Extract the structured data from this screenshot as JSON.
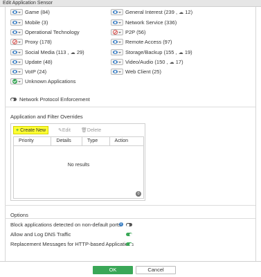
{
  "window": {
    "title": "Edit Application Sensor"
  },
  "categories_left": [
    {
      "icon": "eye-icon",
      "label": "Game (84)"
    },
    {
      "icon": "eye-icon",
      "label": "Mobile (3)"
    },
    {
      "icon": "eye-icon",
      "label": "Operational Technology"
    },
    {
      "icon": "block-icon",
      "label": "Proxy (178)"
    },
    {
      "icon": "eye-icon",
      "label": "Social Media (113 ,",
      "cloud": "29)"
    },
    {
      "icon": "eye-icon",
      "label": "Update (48)"
    },
    {
      "icon": "eye-icon",
      "label": "VoIP (24)"
    },
    {
      "icon": "check-icon",
      "label": "Unknown Applications"
    }
  ],
  "categories_right": [
    {
      "icon": "eye-icon",
      "label": "General Interest (239 ,",
      "cloud": "12)"
    },
    {
      "icon": "eye-icon",
      "label": "Network Service (336)"
    },
    {
      "icon": "block-icon",
      "label": "P2P (56)"
    },
    {
      "icon": "eye-icon",
      "label": "Remote Access (97)"
    },
    {
      "icon": "eye-icon",
      "label": "Storage/Backup (155 ,",
      "cloud": "19)"
    },
    {
      "icon": "eye-icon",
      "label": "Video/Audio (150 ,",
      "cloud": "17)"
    },
    {
      "icon": "eye-icon",
      "label": "Web Client (25)"
    }
  ],
  "network_protocol": {
    "label": "Network Protocol Enforcement",
    "enabled": false
  },
  "overrides": {
    "heading": "Application and Filter Overrides",
    "toolbar": {
      "create": "Create New",
      "edit": "Edit",
      "delete": "Delete"
    },
    "columns": [
      "Priority",
      "Details",
      "Type",
      "Action"
    ],
    "empty_text": "No results",
    "count": "0"
  },
  "options": {
    "heading": "Options",
    "items": [
      {
        "label": "Block applications detected on non-default ports",
        "enabled": false,
        "info": true
      },
      {
        "label": "Allow and Log DNS Traffic",
        "enabled": true
      },
      {
        "label": "Replacement Messages for HTTP-based Applications",
        "enabled": true
      }
    ]
  },
  "footer": {
    "ok": "OK",
    "cancel": "Cancel"
  },
  "colors": {
    "accent_green": "#3aa757",
    "highlight": "#ffff33",
    "eye_blue": "#3b7fc4",
    "block_red": "#d9534f"
  }
}
